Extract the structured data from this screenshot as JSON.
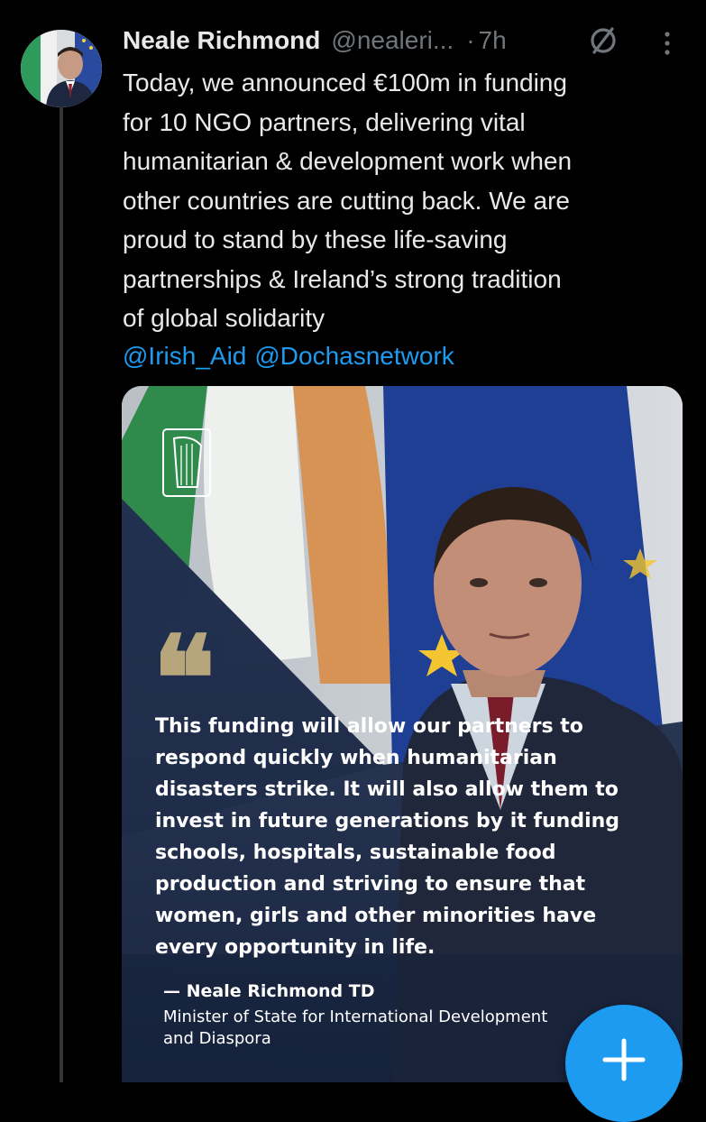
{
  "tweet": {
    "author_name": "Neale Richmond",
    "author_handle": "@nealeri...",
    "separator": "·",
    "timestamp": "7h",
    "avatar_icon": "profile-photo",
    "mute_icon": "mute-slash-icon",
    "more_icon": "more-vertical-icon",
    "body_lines": [
      "Today, we announced €100m in funding",
      "for 10 NGO partners, delivering vital",
      "humanitarian & development work when",
      "other countries are cutting back. We are",
      "proud to stand by these life-saving",
      "partnerships & Ireland’s strong tradition",
      "of global solidarity"
    ],
    "mentions": [
      "@Irish_Aid",
      "@Dochasnetwork"
    ]
  },
  "media_card": {
    "quote_mark": "❝",
    "quote_lines": [
      "This funding will allow our partners to",
      "respond quickly when humanitarian",
      "disasters strike. It will also allow them to",
      "invest in future generations by it funding",
      "schools, hospitals, sustainable food",
      "production and striving to ensure that",
      "women, girls and other minorities have",
      "every opportunity in life."
    ],
    "attribution_name": "— Neale Richmond TD",
    "attribution_role_lines": [
      "Minister of State for International Development",
      "and Diaspora"
    ],
    "emblem_icon": "harp-emblem-icon"
  },
  "compose_button": {
    "icon": "plus-icon"
  },
  "colors": {
    "background": "#000000",
    "text": "#e7e9ea",
    "muted": "#71767b",
    "link": "#1d9bf0",
    "quote_gold": "#b7a67c",
    "card_navy": "#1f2c4a",
    "flag_green": "#2e8b57",
    "eu_blue": "#1e3f9a"
  }
}
